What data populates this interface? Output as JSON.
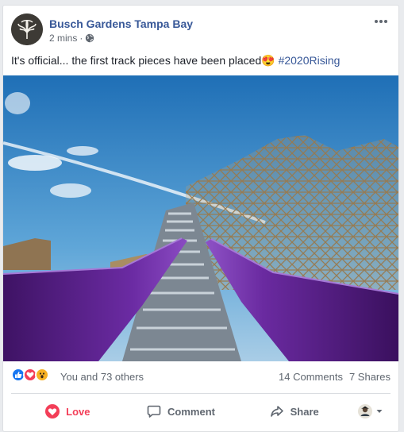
{
  "post": {
    "page_name": "Busch Gardens Tampa Bay",
    "time": "2 mins",
    "dot": "·",
    "text": "It's official... the first track pieces have been placed",
    "emoji": "😍",
    "hashtag": "#2020Rising"
  },
  "reactions": {
    "types": [
      "like",
      "love",
      "wow"
    ],
    "summary": "You and 73 others",
    "comments": "14 Comments",
    "shares": "7 Shares"
  },
  "actions": {
    "love": "Love",
    "comment": "Comment",
    "share": "Share"
  },
  "colors": {
    "link": "#385898",
    "love": "#f33e58",
    "like": "#1877f2",
    "wow": "#f7b125",
    "track_purple": "#6a2aa0"
  }
}
